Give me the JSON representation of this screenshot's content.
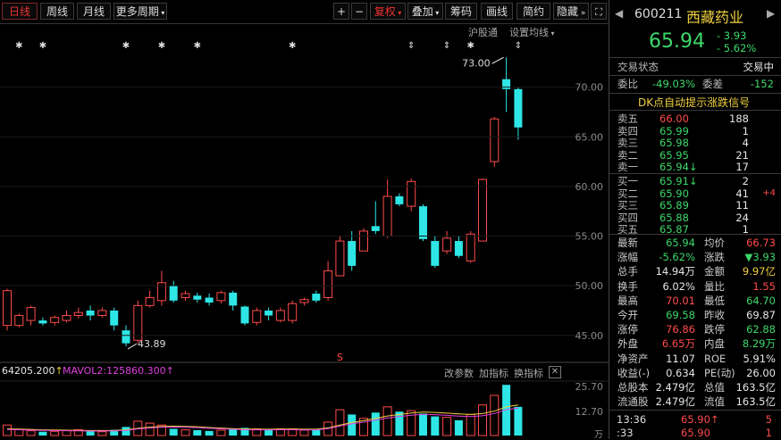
{
  "toolbar": {
    "period_day": "日线",
    "period_week": "周线",
    "period_month": "月线",
    "more_periods": "更多周期",
    "zoom_in": "+",
    "zoom_out": "−",
    "adjust": "复权",
    "overlay": "叠加",
    "chips": "筹码",
    "draw": "画线",
    "brief": "简约",
    "hide": "隐藏"
  },
  "chart_links": {
    "hgt": "沪股通",
    "set_ma": "设置均线"
  },
  "chart": {
    "high_marker": "73.00",
    "low_marker": "43.89",
    "y_ticks": [
      "70.00",
      "65.00",
      "60.00",
      "55.00",
      "50.00",
      "45.00"
    ],
    "volume_label": "64205.200",
    "mavol2_label": "MAVOL2:125860.300",
    "vol_ticks": [
      "25.70",
      "12.70"
    ],
    "vol_unit": "万",
    "btn_params": "改参数",
    "btn_add_ind": "加指标",
    "btn_switch_ind": "换指标"
  },
  "chart_data": {
    "type": "candlestick",
    "ylim": [
      43,
      75
    ],
    "candles": [
      {
        "o": 46.0,
        "c": 49.5,
        "h": 49.7,
        "l": 45.5
      },
      {
        "o": 46.0,
        "c": 47.0,
        "h": 47.2,
        "l": 45.8
      },
      {
        "o": 46.5,
        "c": 47.8,
        "h": 48.0,
        "l": 46.0
      },
      {
        "o": 46.5,
        "c": 46.2,
        "h": 46.8,
        "l": 46.0
      },
      {
        "o": 46.3,
        "c": 46.8,
        "h": 47.0,
        "l": 46.0
      },
      {
        "o": 46.5,
        "c": 47.0,
        "h": 47.5,
        "l": 46.3
      },
      {
        "o": 47.0,
        "c": 47.3,
        "h": 47.8,
        "l": 46.7
      },
      {
        "o": 47.5,
        "c": 47.0,
        "h": 48.0,
        "l": 46.5
      },
      {
        "o": 47.0,
        "c": 47.5,
        "h": 47.8,
        "l": 46.8
      },
      {
        "o": 47.5,
        "c": 46.0,
        "h": 47.8,
        "l": 45.5
      },
      {
        "o": 45.5,
        "c": 44.2,
        "h": 46.0,
        "l": 43.89
      },
      {
        "o": 44.5,
        "c": 48.0,
        "h": 48.5,
        "l": 44.2
      },
      {
        "o": 48.0,
        "c": 48.8,
        "h": 49.5,
        "l": 47.8
      },
      {
        "o": 48.5,
        "c": 50.3,
        "h": 51.5,
        "l": 48.0
      },
      {
        "o": 50.0,
        "c": 48.5,
        "h": 50.5,
        "l": 48.3
      },
      {
        "o": 48.8,
        "c": 49.2,
        "h": 49.5,
        "l": 48.5
      },
      {
        "o": 49.0,
        "c": 48.6,
        "h": 49.3,
        "l": 48.3
      },
      {
        "o": 48.8,
        "c": 48.3,
        "h": 49.2,
        "l": 48.0
      },
      {
        "o": 48.5,
        "c": 49.3,
        "h": 49.5,
        "l": 48.2
      },
      {
        "o": 49.3,
        "c": 48.0,
        "h": 49.5,
        "l": 47.5
      },
      {
        "o": 47.9,
        "c": 46.2,
        "h": 48.0,
        "l": 46.0
      },
      {
        "o": 46.3,
        "c": 47.5,
        "h": 47.8,
        "l": 46.0
      },
      {
        "o": 47.5,
        "c": 47.0,
        "h": 47.8,
        "l": 46.5
      },
      {
        "o": 46.5,
        "c": 47.5,
        "h": 47.8,
        "l": 46.3
      },
      {
        "o": 46.5,
        "c": 48.2,
        "h": 48.5,
        "l": 46.2
      },
      {
        "o": 48.3,
        "c": 48.6,
        "h": 48.8,
        "l": 48.0
      },
      {
        "o": 49.2,
        "c": 48.5,
        "h": 49.5,
        "l": 48.3
      },
      {
        "o": 48.8,
        "c": 51.5,
        "h": 52.5,
        "l": 48.5
      },
      {
        "o": 51.0,
        "c": 54.5,
        "h": 55.0,
        "l": 51.0
      },
      {
        "o": 54.5,
        "c": 52.0,
        "h": 55.5,
        "l": 51.5
      },
      {
        "o": 53.5,
        "c": 55.5,
        "h": 55.8,
        "l": 53.5
      },
      {
        "o": 56.0,
        "c": 55.5,
        "h": 58.5,
        "l": 55.2
      },
      {
        "o": 55.0,
        "c": 59.0,
        "h": 60.7,
        "l": 54.8
      },
      {
        "o": 59.0,
        "c": 58.2,
        "h": 59.3,
        "l": 58.0
      },
      {
        "o": 58.0,
        "c": 60.5,
        "h": 60.8,
        "l": 57.5
      },
      {
        "o": 58.0,
        "c": 54.7,
        "h": 58.2,
        "l": 54.5
      },
      {
        "o": 54.5,
        "c": 52.0,
        "h": 55.0,
        "l": 51.8
      },
      {
        "o": 53.5,
        "c": 54.8,
        "h": 55.5,
        "l": 53.2
      },
      {
        "o": 54.5,
        "c": 53.0,
        "h": 55.0,
        "l": 52.8
      },
      {
        "o": 52.5,
        "c": 55.2,
        "h": 55.5,
        "l": 52.3
      },
      {
        "o": 54.5,
        "c": 60.7,
        "h": 60.8,
        "l": 54.5
      },
      {
        "o": 62.5,
        "c": 66.8,
        "h": 67.0,
        "l": 62.0
      },
      {
        "o": 70.8,
        "c": 69.8,
        "h": 73.0,
        "l": 67.5
      },
      {
        "o": 69.8,
        "c": 65.94,
        "h": 70.01,
        "l": 64.7
      }
    ],
    "volume_ylim": [
      0,
      28
    ],
    "volumes": [
      5.5,
      3.0,
      2.5,
      2.0,
      2.2,
      2.6,
      3.1,
      2.3,
      2.0,
      3.0,
      4.5,
      7.5,
      6.5,
      5.5,
      3.5,
      3.0,
      2.8,
      2.4,
      2.8,
      3.2,
      4.0,
      3.5,
      3.2,
      3.5,
      3.5,
      2.8,
      2.9,
      7.0,
      13.5,
      11.0,
      9.0,
      12.0,
      15.0,
      12.5,
      13.0,
      11.5,
      10.0,
      9.5,
      8.0,
      11.0,
      16.0,
      21.0,
      26.5,
      15.0
    ],
    "ma_line": [
      3.5,
      3.4,
      3.2,
      3.0,
      2.9,
      2.8,
      2.7,
      2.6,
      2.6,
      2.7,
      3.0,
      3.8,
      4.4,
      4.8,
      4.9,
      4.8,
      4.6,
      4.2,
      3.9,
      3.6,
      3.4,
      3.3,
      3.3,
      3.4,
      3.4,
      3.3,
      3.3,
      4.0,
      5.5,
      6.8,
      7.8,
      9.0,
      10.2,
      11.0,
      11.8,
      12.3,
      12.1,
      11.7,
      11.3,
      11.0,
      11.5,
      12.8,
      15.0,
      16.0
    ]
  },
  "quote": {
    "code": "600211",
    "name": "西藏药业",
    "price": "65.94",
    "change": "- 3.93",
    "change_pct": "- 5.62%",
    "status_label": "交易状态",
    "status_value": "交易中",
    "weibi_label": "委比",
    "weibi_value": "-49.03%",
    "weicha_label": "委差",
    "weicha_value": "-152",
    "dk_banner": "DK点自动提示涨跌信号"
  },
  "order_book": {
    "asks": [
      {
        "label": "卖五",
        "price": "66.00",
        "vol": "188",
        "color": "#ff4a4a"
      },
      {
        "label": "卖四",
        "price": "65.99",
        "vol": "1",
        "color": "#3dd86a"
      },
      {
        "label": "卖三",
        "price": "65.98",
        "vol": "4",
        "color": "#3dd86a"
      },
      {
        "label": "卖二",
        "price": "65.95",
        "vol": "21",
        "color": "#3dd86a"
      },
      {
        "label": "卖一",
        "price": "65.94↓",
        "vol": "17",
        "color": "#3dd86a"
      }
    ],
    "bids": [
      {
        "label": "买一",
        "price": "65.91↓",
        "vol": "2",
        "extra": "",
        "color": "#3dd86a"
      },
      {
        "label": "买二",
        "price": "65.90",
        "vol": "41",
        "extra": "+4",
        "color": "#3dd86a"
      },
      {
        "label": "买三",
        "price": "65.89",
        "vol": "11",
        "extra": "",
        "color": "#3dd86a"
      },
      {
        "label": "买四",
        "price": "65.88",
        "vol": "24",
        "extra": "",
        "color": "#3dd86a"
      },
      {
        "label": "买五",
        "price": "65.87",
        "vol": "1",
        "extra": "",
        "color": "#3dd86a"
      }
    ]
  },
  "stats": [
    {
      "l1": "最新",
      "v1": "65.94",
      "c1": "#3dd86a",
      "l2": "均价",
      "v2": "66.73",
      "c2": "#ff4a4a"
    },
    {
      "l1": "涨幅",
      "v1": "-5.62%",
      "c1": "#3dd86a",
      "l2": "涨跌",
      "v2": "▼3.93",
      "c2": "#3dd86a"
    },
    {
      "l1": "总手",
      "v1": "14.94万",
      "c1": "#e6e6e6",
      "l2": "金额",
      "v2": "9.97亿",
      "c2": "#f0d040"
    },
    {
      "l1": "换手",
      "v1": "6.02%",
      "c1": "#e6e6e6",
      "l2": "量比",
      "v2": "1.55",
      "c2": "#ff4a4a"
    },
    {
      "l1": "最高",
      "v1": "70.01",
      "c1": "#ff4a4a",
      "l2": "最低",
      "v2": "64.70",
      "c2": "#3dd86a"
    },
    {
      "l1": "今开",
      "v1": "69.58",
      "c1": "#3dd86a",
      "l2": "昨收",
      "v2": "69.87",
      "c2": "#e6e6e6"
    },
    {
      "l1": "涨停",
      "v1": "76.86",
      "c1": "#ff4a4a",
      "l2": "跌停",
      "v2": "62.88",
      "c2": "#3dd86a"
    },
    {
      "l1": "外盘",
      "v1": "6.65万",
      "c1": "#ff4a4a",
      "l2": "内盘",
      "v2": "8.29万",
      "c2": "#3dd86a"
    },
    {
      "l1": "净资产",
      "v1": "11.07",
      "c1": "#e6e6e6",
      "l2": "ROE",
      "v2": "5.91%",
      "c2": "#e6e6e6"
    },
    {
      "l1": "收益(-)",
      "v1": "0.634",
      "c1": "#e6e6e6",
      "l2": "PE(动)",
      "v2": "26.00",
      "c2": "#e6e6e6"
    },
    {
      "l1": "总股本",
      "v1": "2.479亿",
      "c1": "#e6e6e6",
      "l2": "总值",
      "v2": "163.5亿",
      "c2": "#e6e6e6"
    },
    {
      "l1": "流通股",
      "v1": "2.479亿",
      "c1": "#e6e6e6",
      "l2": "流值",
      "v2": "163.5亿",
      "c2": "#e6e6e6"
    }
  ],
  "ticks": [
    {
      "time": "13:36",
      "price": "65.90↑",
      "vol": "5"
    },
    {
      "time": ":33",
      "price": "65.90",
      "vol": "1"
    }
  ]
}
